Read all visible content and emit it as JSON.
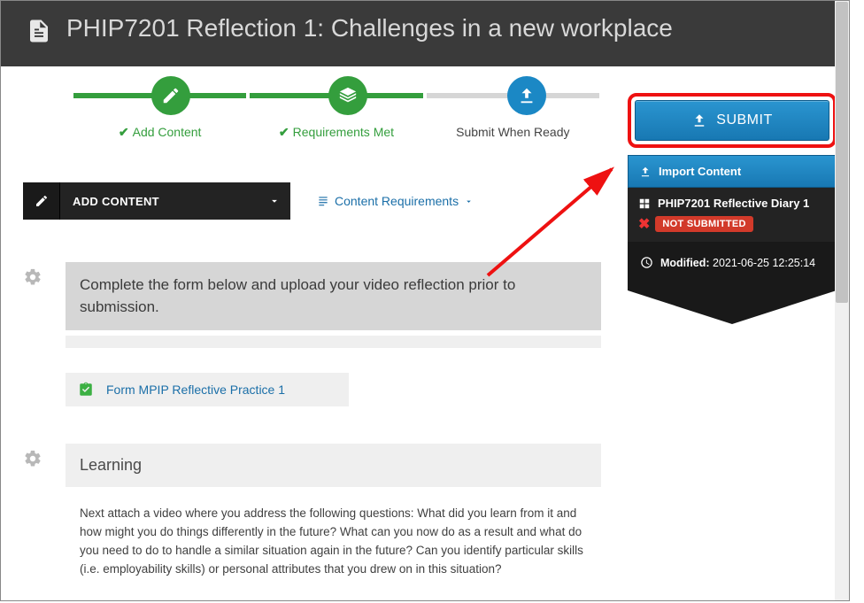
{
  "header": {
    "title": "PHIP7201 Reflection 1: Challenges in a new workplace"
  },
  "progress": {
    "step1": "Add Content",
    "step2": "Requirements Met",
    "step3": "Submit When Ready"
  },
  "toolbar": {
    "add_content": "ADD CONTENT",
    "content_requirements": "Content Requirements"
  },
  "instruction": "Complete the form below and upload your video reflection prior to submission.",
  "form_link": "Form MPIP Reflective Practice 1",
  "learning": {
    "heading": "Learning",
    "body": "Next attach a video where you address the following questions: What did you learn from it and how might you do things differently in the future? What can you now do as a result and what do you need to do to handle a similar situation again in the future? Can you identify particular skills (i.e. employability skills) or personal attributes that you drew on in this situation?"
  },
  "sidebar": {
    "submit": "SUBMIT",
    "import": "Import Content",
    "diary_title": "PHIP7201 Reflective Diary 1",
    "status_badge": "NOT SUBMITTED",
    "modified_label": "Modified:",
    "modified_value": "2021-06-25 12:25:14"
  }
}
